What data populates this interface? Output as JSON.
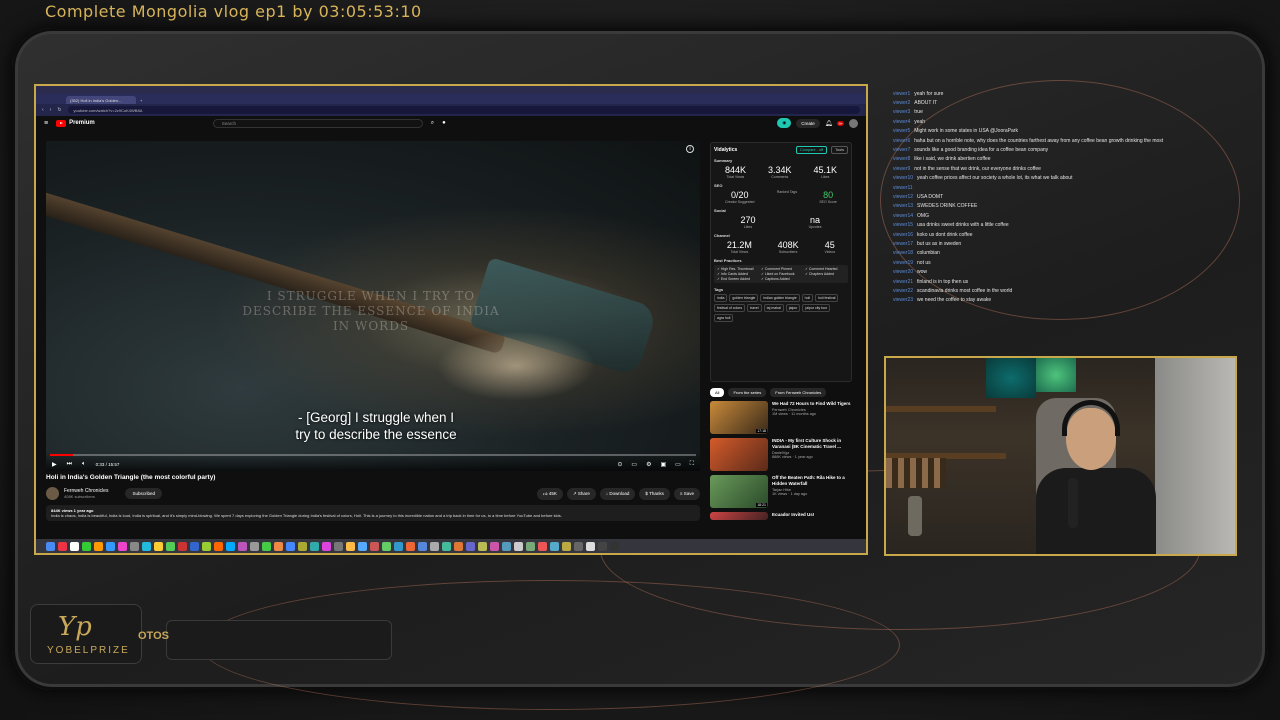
{
  "stream_title": "Complete Mongolia vlog ep1 by 03:05:53:10",
  "branding": {
    "logo_text": "YOBELPRIZE",
    "logo_suffix": "OTOS"
  },
  "browser": {
    "tab_title": "(352) Holi in India's Golden...",
    "url": "youtube.com/watch?v=2z9CuK4WB8A"
  },
  "youtube": {
    "logo_label": "Premium",
    "search_placeholder": "Search",
    "create_label": "Create",
    "notification_count": "9+",
    "video": {
      "faint_overlay_text": "I STRUGGLE WHEN I TRY TO DESCRIBE THE ESSENCE OF INDIA IN WORDS",
      "caption_line1": "- [Georg] I struggle when I",
      "caption_line2": "try to describe the essence",
      "time": "0:33 / 15:57",
      "progress": 0.035
    },
    "title": "Holi in India's Golden Triangle (the most colorful party)",
    "channel": "Fernweh Chronicles",
    "subscribers": "408K subscribers",
    "subscribed_label": "Subscribed",
    "likes": "45K",
    "share_label": "Share",
    "download_label": "Download",
    "thanks_label": "Thanks",
    "save_label": "Save",
    "views_line": "844K views  1 year ago",
    "description": "India is chaos, India is beautiful, India is loud, India is spiritual, and it's simply mind-blowing. We spent 7 days exploring the Golden Triangle during India's festival of colors, Holi. This is a journey to this incredible nation and a trip back in time for us, to a time before YouTube and before kids."
  },
  "vidalytics": {
    "title": "Vidalytics",
    "compare_label": "Compare - off",
    "tools_label": "Tools",
    "summary_label": "Summary",
    "summary": [
      {
        "value": "844K",
        "label": "Total Views"
      },
      {
        "value": "3.34K",
        "label": "Comments"
      },
      {
        "value": "45.1K",
        "label": "Likes"
      }
    ],
    "seo_label": "SEO",
    "seo": [
      {
        "value": "0/20",
        "label": "Creator Suggested"
      },
      {
        "value": "",
        "label": "Ranked Tags"
      },
      {
        "value": "80",
        "label": "SEO Score"
      }
    ],
    "social_label": "Social",
    "social": [
      {
        "value": "270",
        "label": "Likes"
      },
      {
        "value": "na",
        "label": "Upvotes"
      }
    ],
    "channel_label": "Channel",
    "channel": [
      {
        "value": "21.2M",
        "label": "Total Views"
      },
      {
        "value": "408K",
        "label": "Subscribers"
      },
      {
        "value": "45",
        "label": "Videos"
      }
    ],
    "best_practices_label": "Best Practices",
    "best_practices": [
      "High Res. Thumbnail",
      "Comment Pinned",
      "Comment Hearted",
      "Info Cards Added",
      "Liked on Facebook",
      "Chapters Added",
      "End Screen Added",
      "Captions Added"
    ],
    "tags_label": "Tags",
    "tags": [
      "india",
      "golden triangle",
      "indian golden triangle",
      "holi",
      "holi festival",
      "festival of colors",
      "travel",
      "taj mahal",
      "jaipur",
      "jaipur city tour",
      "agra holi"
    ]
  },
  "recommendations": {
    "chips": [
      "All",
      "From the series",
      "From Fernweh Chronicles"
    ],
    "items": [
      {
        "title": "We Had 72 Hours to Find Wild Tigers",
        "channel": "Fernweh Chronicles",
        "meta": "1M views · 11 months ago",
        "duration": "17:18"
      },
      {
        "title": "INDIA - My first Culture Shock in Varanasi (8K Cinematic Travel ...",
        "channel": "DanielVgz",
        "meta": "886K views · 1 year ago",
        "duration": ""
      },
      {
        "title": "Off the Beaten Path: Rila Hike to a Hidden Waterfall",
        "channel": "Tarjan Hike",
        "meta": "1K views · 1 day ago",
        "duration": "18:21"
      },
      {
        "title": "Ecuador Invited Us!",
        "channel": "",
        "meta": "",
        "duration": ""
      }
    ]
  },
  "chat": [
    {
      "user": "viewer1",
      "msg": "yeah for sure"
    },
    {
      "user": "viewer2",
      "msg": "ABOUT IT"
    },
    {
      "user": "viewer3",
      "msg": "true"
    },
    {
      "user": "viewer4",
      "msg": "yeah"
    },
    {
      "user": "viewer5",
      "msg": "Might work in some states in USA @JooraPark"
    },
    {
      "user": "viewer6",
      "msg": "haha but on a horrible note, why does the countries farthest away from any coffee bean growth drinking the most"
    },
    {
      "user": "viewer7",
      "msg": "sounds like a good branding idea for a coffee bean company"
    },
    {
      "user": "viewer8",
      "msg": "like i said, we drink abertien coffee"
    },
    {
      "user": "viewer9",
      "msg": "not in the sense that we drink, our everyone drinks coffee"
    },
    {
      "user": "viewer10",
      "msg": "yeah coffee prices affect our society a whole lot, its what we talk about"
    },
    {
      "user": "viewer11",
      "msg": ""
    },
    {
      "user": "viewer12",
      "msg": "USA DOMT"
    },
    {
      "user": "viewer13",
      "msg": "SWEDES DRINK COFFEE"
    },
    {
      "user": "viewer14",
      "msg": "OMG"
    },
    {
      "user": "viewer15",
      "msg": "usa drinks sweet drinks with a little coffee"
    },
    {
      "user": "viewer16",
      "msg": "koko us dont drink coffee"
    },
    {
      "user": "viewer17",
      "msg": "but us as in sweden"
    },
    {
      "user": "viewer18",
      "msg": "columbian"
    },
    {
      "user": "viewer19",
      "msg": "not us"
    },
    {
      "user": "viewer20",
      "msg": "wow"
    },
    {
      "user": "viewer21",
      "msg": "finland is in top then us"
    },
    {
      "user": "viewer22",
      "msg": "scandinavia drinks most coffee in the world"
    },
    {
      "user": "viewer23",
      "msg": "we need the coffee to stay awake"
    }
  ],
  "colors": {
    "accent_gold": "#c9a84c",
    "teal": "#1fc8b3",
    "yt_red": "#ff0000"
  }
}
